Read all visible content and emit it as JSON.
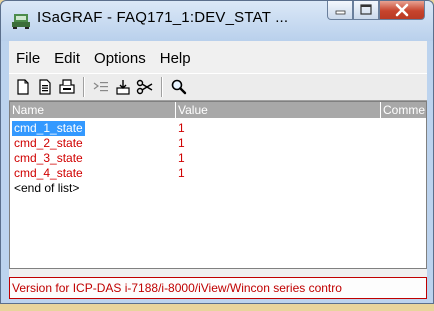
{
  "window": {
    "title": "ISaGRAF - FAQ171_1:DEV_STAT ..."
  },
  "menu": [
    "File",
    "Edit",
    "Options",
    "Help"
  ],
  "toolbar": {
    "icons": [
      "new-file-icon",
      "paste-document-icon",
      "print-icon",
      "indent-icon",
      "import-icon",
      "cut-icon",
      "search-icon"
    ]
  },
  "grid": {
    "columns": [
      "Name",
      "Value",
      "Comme"
    ],
    "rows": [
      {
        "name": "cmd_1_state",
        "value": "1",
        "selected": true
      },
      {
        "name": "cmd_2_state",
        "value": "1"
      },
      {
        "name": "cmd_3_state",
        "value": "1"
      },
      {
        "name": "cmd_4_state",
        "value": "1"
      }
    ],
    "end_marker": "<end of list>"
  },
  "status": {
    "text": "Version for ICP-DAS i-7188/i-8000/iView/Wincon series contro"
  },
  "colors": {
    "variable_text": "#d00000",
    "selection": "#3399ff",
    "status_border": "#c00000"
  }
}
